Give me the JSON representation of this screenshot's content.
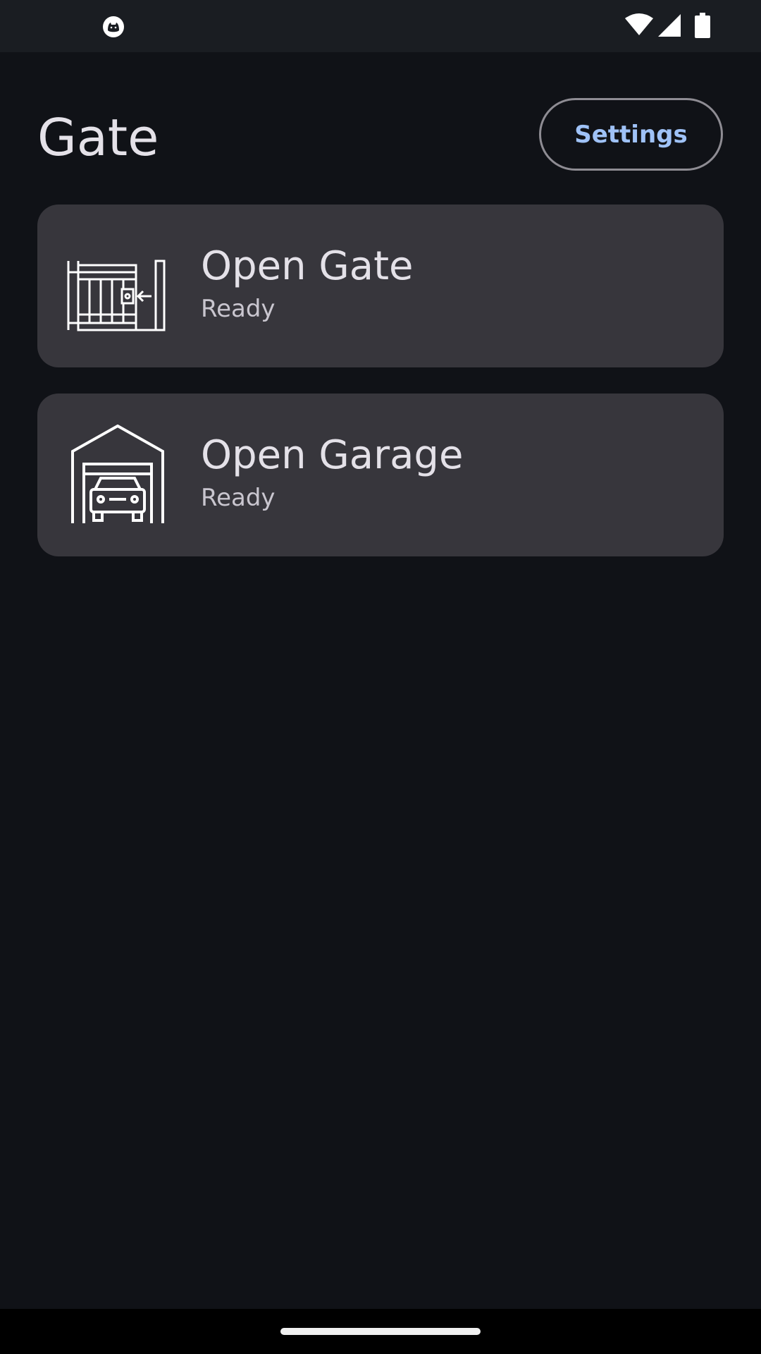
{
  "status_bar": {
    "left_icon": "notification-cat-icon",
    "right_icons": [
      "wifi-icon",
      "cellular-signal-icon",
      "battery-icon"
    ]
  },
  "header": {
    "title": "Gate",
    "settings_label": "Settings"
  },
  "cards": [
    {
      "title": "Open Gate",
      "status": "Ready",
      "icon": "sliding-gate-icon"
    },
    {
      "title": "Open Garage",
      "status": "Ready",
      "icon": "garage-car-icon"
    }
  ],
  "colors": {
    "background": "#101217",
    "card": "#37363c",
    "accent": "#9fc2f7",
    "text_primary": "#e4e1e8",
    "text_secondary": "#c9c6cf"
  }
}
